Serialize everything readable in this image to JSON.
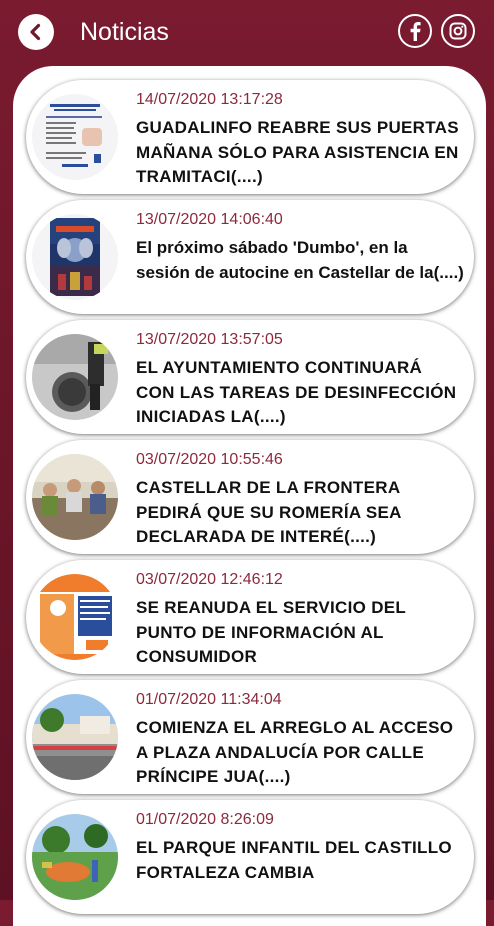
{
  "header": {
    "title": "Noticias",
    "back_icon": "chevron-left-icon",
    "social": [
      {
        "name": "facebook",
        "icon": "facebook-icon"
      },
      {
        "name": "instagram",
        "icon": "instagram-icon"
      }
    ]
  },
  "colors": {
    "brand": "#6e1a2e",
    "date": "#8c2a3d",
    "card_bg": "#ffffff"
  },
  "news": [
    {
      "date": "14/07/2020 13:17:28",
      "title": "GUADALINFO REABRE SUS PUERTAS MAÑANA SÓLO PARA ASISTENCIA EN TRAMITACI(....)"
    },
    {
      "date": "13/07/2020 14:06:40",
      "title": "El próximo sábado 'Dumbo', en la sesión de autocine en Castellar de la(....)"
    },
    {
      "date": "13/07/2020 13:57:05",
      "title": "EL AYUNTAMIENTO CONTINUARÁ CON LAS TAREAS DE DESINFECCIÓN INICIADAS LA(....)"
    },
    {
      "date": "03/07/2020 10:55:46",
      "title": "CASTELLAR DE LA FRONTERA PEDIRÁ QUE SU ROMERÍA SEA DECLARADA DE INTERÉ(....)"
    },
    {
      "date": "03/07/2020 12:46:12",
      "title": "SE REANUDA EL SERVICIO DEL PUNTO DE INFORMACIÓN AL CONSUMIDOR"
    },
    {
      "date": "01/07/2020 11:34:04",
      "title": "COMIENZA EL ARREGLO AL ACCESO A PLAZA ANDALUCÍA POR CALLE PRÍNCIPE JUA(....)"
    },
    {
      "date": "01/07/2020 8:26:09",
      "title": "EL PARQUE INFANTIL DEL CASTILLO FORTALEZA CAMBIA"
    }
  ]
}
